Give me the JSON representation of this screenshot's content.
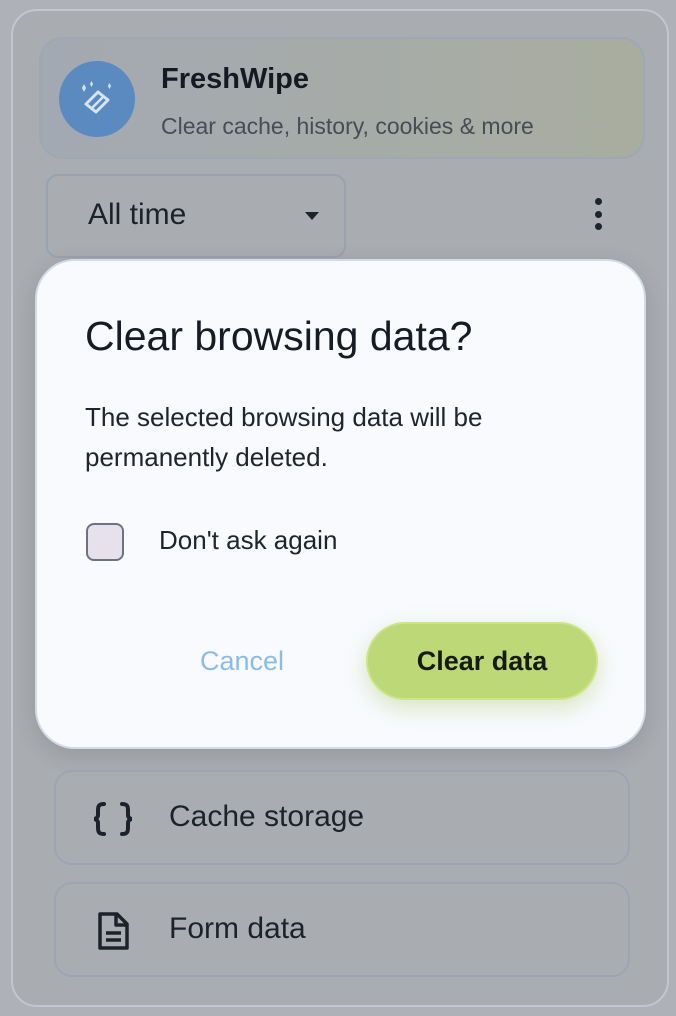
{
  "app": {
    "name": "FreshWipe",
    "subtitle": "Clear cache, history, cookies & more"
  },
  "time_range": {
    "selected": "All time"
  },
  "list": {
    "items": [
      {
        "label": "Cache storage",
        "icon": "braces-icon"
      },
      {
        "label": "Form data",
        "icon": "document-icon"
      }
    ]
  },
  "dialog": {
    "title": "Clear browsing data?",
    "body": "The selected browsing data will be permanently deleted.",
    "checkbox_label": "Don't ask again",
    "checkbox_checked": false,
    "cancel_label": "Cancel",
    "confirm_label": "Clear data"
  },
  "colors": {
    "accent": "#bcd877",
    "link": "#89bde8",
    "logo": "#5a8ac0",
    "dialog_bg": "#f8fafd"
  }
}
